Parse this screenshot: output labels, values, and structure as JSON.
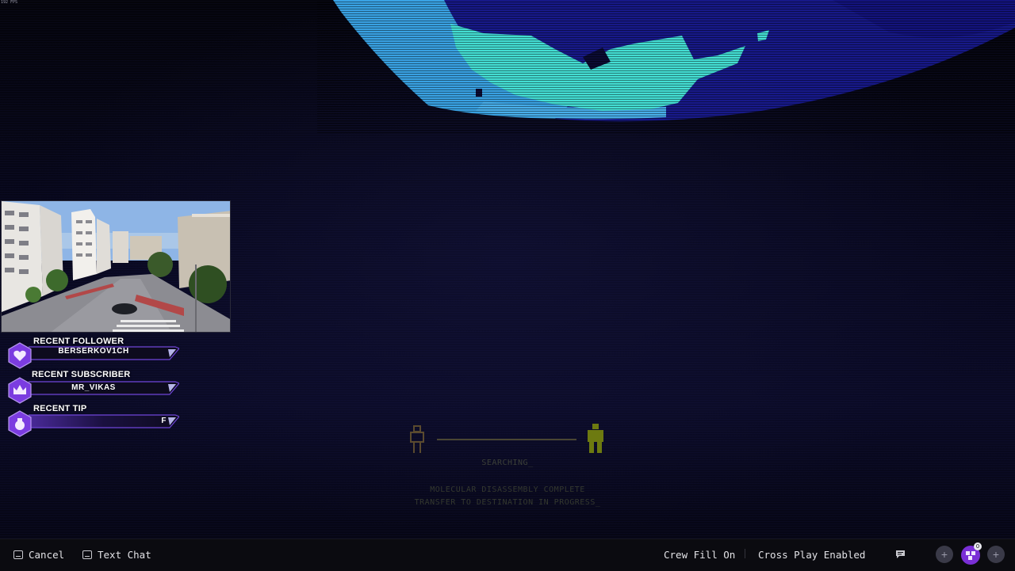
{
  "overlay": {
    "fps": "192 FPS",
    "alerts": [
      {
        "header": "RECENT FOLLOWER",
        "value": "BERSERKOV1CH",
        "icon": "heart-icon"
      },
      {
        "header": "RECENT SUBSCRIBER",
        "value": "MR_VIKAS",
        "icon": "crown-icon"
      },
      {
        "header": "RECENT TIP",
        "value": "F",
        "icon": "money-bag-icon"
      }
    ]
  },
  "loading": {
    "status": "SEARCHING_",
    "line1": "MOLECULAR DISASSEMBLY COMPLETE",
    "line2": "TRANSFER TO DESTINATION IN PROGRESS_",
    "accent": "#c7d13a"
  },
  "bottom_bar": {
    "cancel_label": "Cancel",
    "text_chat_label": "Text Chat",
    "crew_fill_label": "Crew Fill On",
    "cross_play_label": "Cross Play Enabled",
    "notification_badge": "0"
  },
  "colors": {
    "holo_cyan": "#45e6d8",
    "holo_blue": "#3aa7e8",
    "holo_deep": "#1c1fa8",
    "alert_purple": "#7b3ce0",
    "bar_bg": "#0d0b1e"
  }
}
